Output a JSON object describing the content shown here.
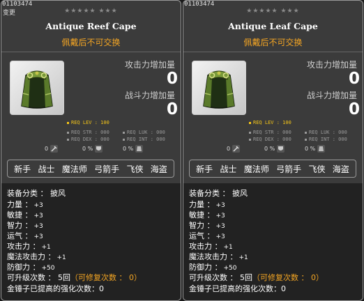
{
  "cards": [
    {
      "item_id": "01103474",
      "tag": "变更",
      "stars": "★★★★★ ★★★",
      "name": "Antique Reef Cape",
      "subtitle": "佩戴后不可交换",
      "stats": [
        {
          "label": "攻击力增加量",
          "value": "0"
        },
        {
          "label": "战斗力增加量",
          "value": "0"
        }
      ],
      "req_lev": "REQ LEV : 100",
      "reqs": [
        "REQ STR : 000",
        "REQ LUK : 000",
        "REQ DEX : 000",
        "REQ INT : 000"
      ],
      "rates": [
        {
          "num": "0",
          "icon": "sword-icon"
        },
        {
          "num": "0 %",
          "icon": "shield-icon"
        },
        {
          "num": "0 %",
          "icon": "armor-icon"
        }
      ],
      "jobs": [
        "新手",
        "战士",
        "魔法师",
        "弓箭手",
        "飞侠",
        "海盗"
      ],
      "details": {
        "category_label": "装备分类 ：",
        "category_value": "披风",
        "str_label": "力量 ：",
        "str_value": "+3",
        "dex_label": "敏捷 ：",
        "dex_value": "+3",
        "int_label": "智力 ：",
        "int_value": "+3",
        "luk_label": "运气 ：",
        "luk_value": "+3",
        "atk_label": "攻击力 ：",
        "atk_value": "+1",
        "matk_label": "魔法攻击力 ：",
        "matk_value": "+1",
        "def_label": "防御力 ：",
        "def_value": "+50",
        "upgrade_label": "可升级次数 ： 5回",
        "upgrade_repair": "（可修复次数 ： 0）",
        "hammer": "金锤子已提高的强化次数：0"
      }
    },
    {
      "item_id": "01103474",
      "tag": "",
      "stars": "★★★★★ ★★★",
      "name": "Antique Leaf Cape",
      "subtitle": "佩戴后不可交换",
      "stats": [
        {
          "label": "攻击力增加量",
          "value": "0"
        },
        {
          "label": "战斗力增加量",
          "value": "0"
        }
      ],
      "req_lev": "REQ LEV : 100",
      "reqs": [
        "REQ STR : 000",
        "REQ LUK : 000",
        "REQ DEX : 000",
        "REQ INT : 000"
      ],
      "rates": [
        {
          "num": "0",
          "icon": "sword-icon"
        },
        {
          "num": "0 %",
          "icon": "shield-icon"
        },
        {
          "num": "0 %",
          "icon": "armor-icon"
        }
      ],
      "jobs": [
        "新手",
        "战士",
        "魔法师",
        "弓箭手",
        "飞侠",
        "海盗"
      ],
      "details": {
        "category_label": "装备分类 ：",
        "category_value": "披风",
        "str_label": "力量 ：",
        "str_value": "+3",
        "dex_label": "敏捷 ：",
        "dex_value": "+3",
        "int_label": "智力 ：",
        "int_value": "+3",
        "luk_label": "运气 ：",
        "luk_value": "+3",
        "atk_label": "攻击力 ：",
        "atk_value": "+1",
        "matk_label": "魔法攻击力 ：",
        "matk_value": "+1",
        "def_label": "防御力 ：",
        "def_value": "+50",
        "upgrade_label": "可升级次数 ： 5回",
        "upgrade_repair": "（可修复次数 ： 0）",
        "hammer": "金锤子已提高的强化次数：0"
      }
    }
  ],
  "colors": {
    "accent_orange": "#f5a623",
    "req_yellow": "#f5c518",
    "panel": "#3b3b3b",
    "detail_bg": "#222222"
  }
}
